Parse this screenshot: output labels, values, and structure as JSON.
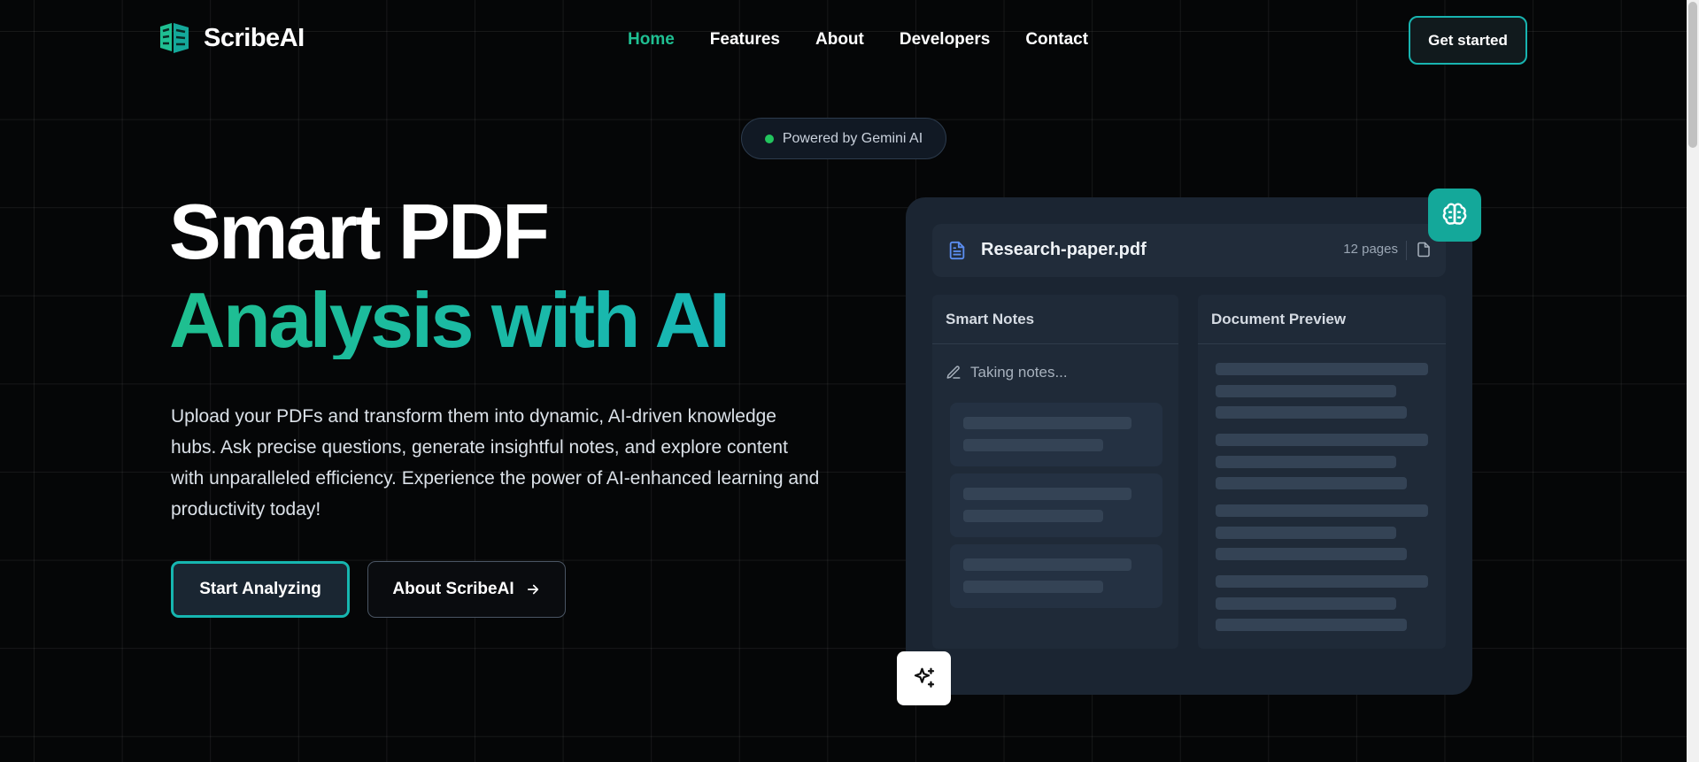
{
  "brand": {
    "name": "ScribeAI"
  },
  "nav": {
    "items": [
      {
        "label": "Home",
        "active": true
      },
      {
        "label": "Features",
        "active": false
      },
      {
        "label": "About",
        "active": false
      },
      {
        "label": "Developers",
        "active": false
      },
      {
        "label": "Contact",
        "active": false
      }
    ],
    "cta_label": "Get started"
  },
  "badge": {
    "label": "Powered by Gemini AI"
  },
  "hero": {
    "title_line1": "Smart PDF",
    "title_line2": "Analysis with AI",
    "description": "Upload your PDFs and transform them into dynamic, AI-driven knowledge hubs. Ask precise questions, generate insightful notes, and explore content with unparalleled efficiency. Experience the power of AI-enhanced learning and productivity today!",
    "primary_button": "Start Analyzing",
    "secondary_button": "About ScribeAI"
  },
  "preview": {
    "file_name": "Research-paper.pdf",
    "page_count": "12 pages",
    "notes_title": "Smart Notes",
    "notes_status": "Taking notes...",
    "preview_title": "Document Preview"
  },
  "colors": {
    "accent_green": "#1fbf92",
    "accent_teal": "#16b6b0",
    "background": "#050607",
    "card": "#1b2532"
  },
  "icons": [
    "logo-icon",
    "file-text-icon",
    "document-icon",
    "brain-icon",
    "pencil-icon",
    "arrow-right-icon",
    "sparkles-icon"
  ]
}
